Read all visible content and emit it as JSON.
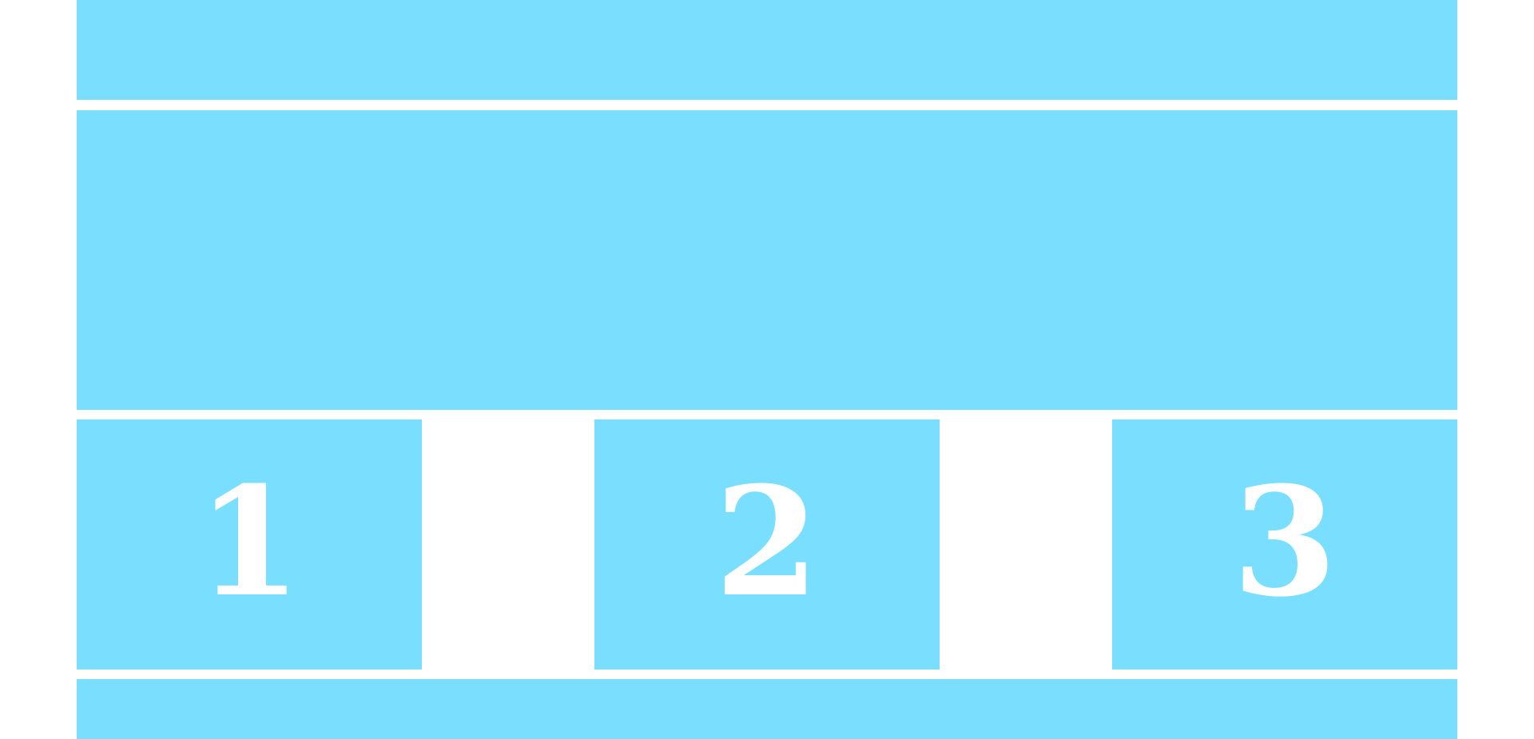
{
  "theme": {
    "block_color": "#7adeff",
    "background_color": "#ffffff",
    "text_color": "#ffffff"
  },
  "cards": [
    {
      "label": "1"
    },
    {
      "label": "2"
    },
    {
      "label": "3"
    }
  ]
}
